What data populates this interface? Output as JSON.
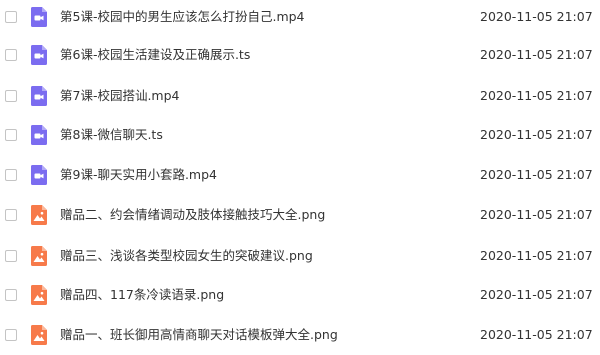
{
  "colors": {
    "video_icon": "#7b6cf0",
    "image_icon": "#f77a4a",
    "text": "#333333",
    "checkbox_border": "#c4c4c4"
  },
  "files": [
    {
      "name": "第5课-校园中的男生应该怎么打扮自己.mp4",
      "date": "2020-11-05 21:07",
      "icon": "video-icon"
    },
    {
      "name": "第6课-校园生活建设及正确展示.ts",
      "date": "2020-11-05 21:07",
      "icon": "video-icon"
    },
    {
      "name": "第7课-校园搭讪.mp4",
      "date": "2020-11-05 21:07",
      "icon": "video-icon"
    },
    {
      "name": "第8课-微信聊天.ts",
      "date": "2020-11-05 21:07",
      "icon": "video-icon"
    },
    {
      "name": "第9课-聊天实用小套路.mp4",
      "date": "2020-11-05 21:07",
      "icon": "video-icon"
    },
    {
      "name": "赠品二、约会情绪调动及肢体接触技巧大全.png",
      "date": "2020-11-05 21:07",
      "icon": "image-icon"
    },
    {
      "name": "赠品三、浅谈各类型校园女生的突破建议.png",
      "date": "2020-11-05 21:07",
      "icon": "image-icon"
    },
    {
      "name": "赠品四、117条冷读语录.png",
      "date": "2020-11-05 21:07",
      "icon": "image-icon"
    },
    {
      "name": "赠品一、班长御用高情商聊天对话模板弹大全.png",
      "date": "2020-11-05 21:07",
      "icon": "image-icon"
    }
  ]
}
